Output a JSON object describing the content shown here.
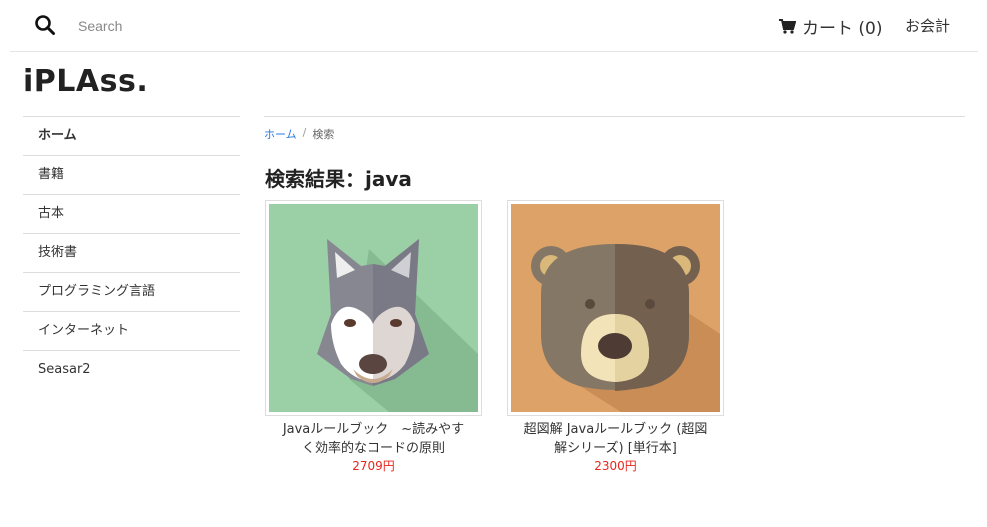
{
  "header": {
    "search_placeholder": "Search",
    "cart_label": "カート (0)",
    "checkout_label": "お会計"
  },
  "brand": {
    "logo": "iPLAss."
  },
  "sidebar": {
    "items": [
      {
        "label": "ホーム"
      },
      {
        "label": "書籍"
      },
      {
        "label": "古本"
      },
      {
        "label": "技術書"
      },
      {
        "label": "プログラミング言語"
      },
      {
        "label": "インターネット"
      },
      {
        "label": "Seasar2"
      }
    ]
  },
  "breadcrumb": {
    "home": "ホーム",
    "separator": "/",
    "current": "検索"
  },
  "main": {
    "title": "検索結果：java"
  },
  "products": [
    {
      "name_line1": "Javaルールブック　~読みやす",
      "name_line2": "く効率的なコードの原則",
      "price": "2709円",
      "image": "wolf-illustration",
      "bg_color": "#9bcfa5"
    },
    {
      "name_line1": "超図解 Javaルールブック (超図",
      "name_line2": "解シリーズ) [単行本]",
      "price": "2300円",
      "image": "bear-illustration",
      "bg_color": "#dca267"
    }
  ],
  "colors": {
    "price": "#e8261d",
    "link": "#2a7ae2"
  }
}
